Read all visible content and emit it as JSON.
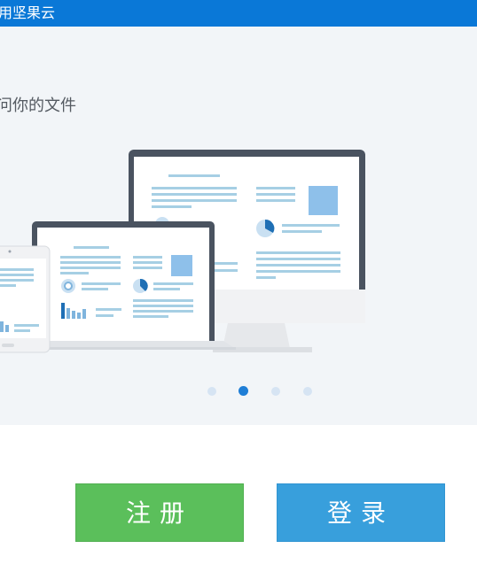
{
  "window": {
    "title": "用坚果云"
  },
  "hero": {
    "headline": "问你的文件"
  },
  "carousel": {
    "dot_count": 4,
    "active_index": 1
  },
  "actions": {
    "register_label": "注册",
    "login_label": "登录"
  },
  "colors": {
    "titlebar": "#0a78d7",
    "register_button": "#5bbf5b",
    "login_button": "#389fdc",
    "active_dot": "#1f7ed6",
    "inactive_dot": "#d6e4f3"
  }
}
